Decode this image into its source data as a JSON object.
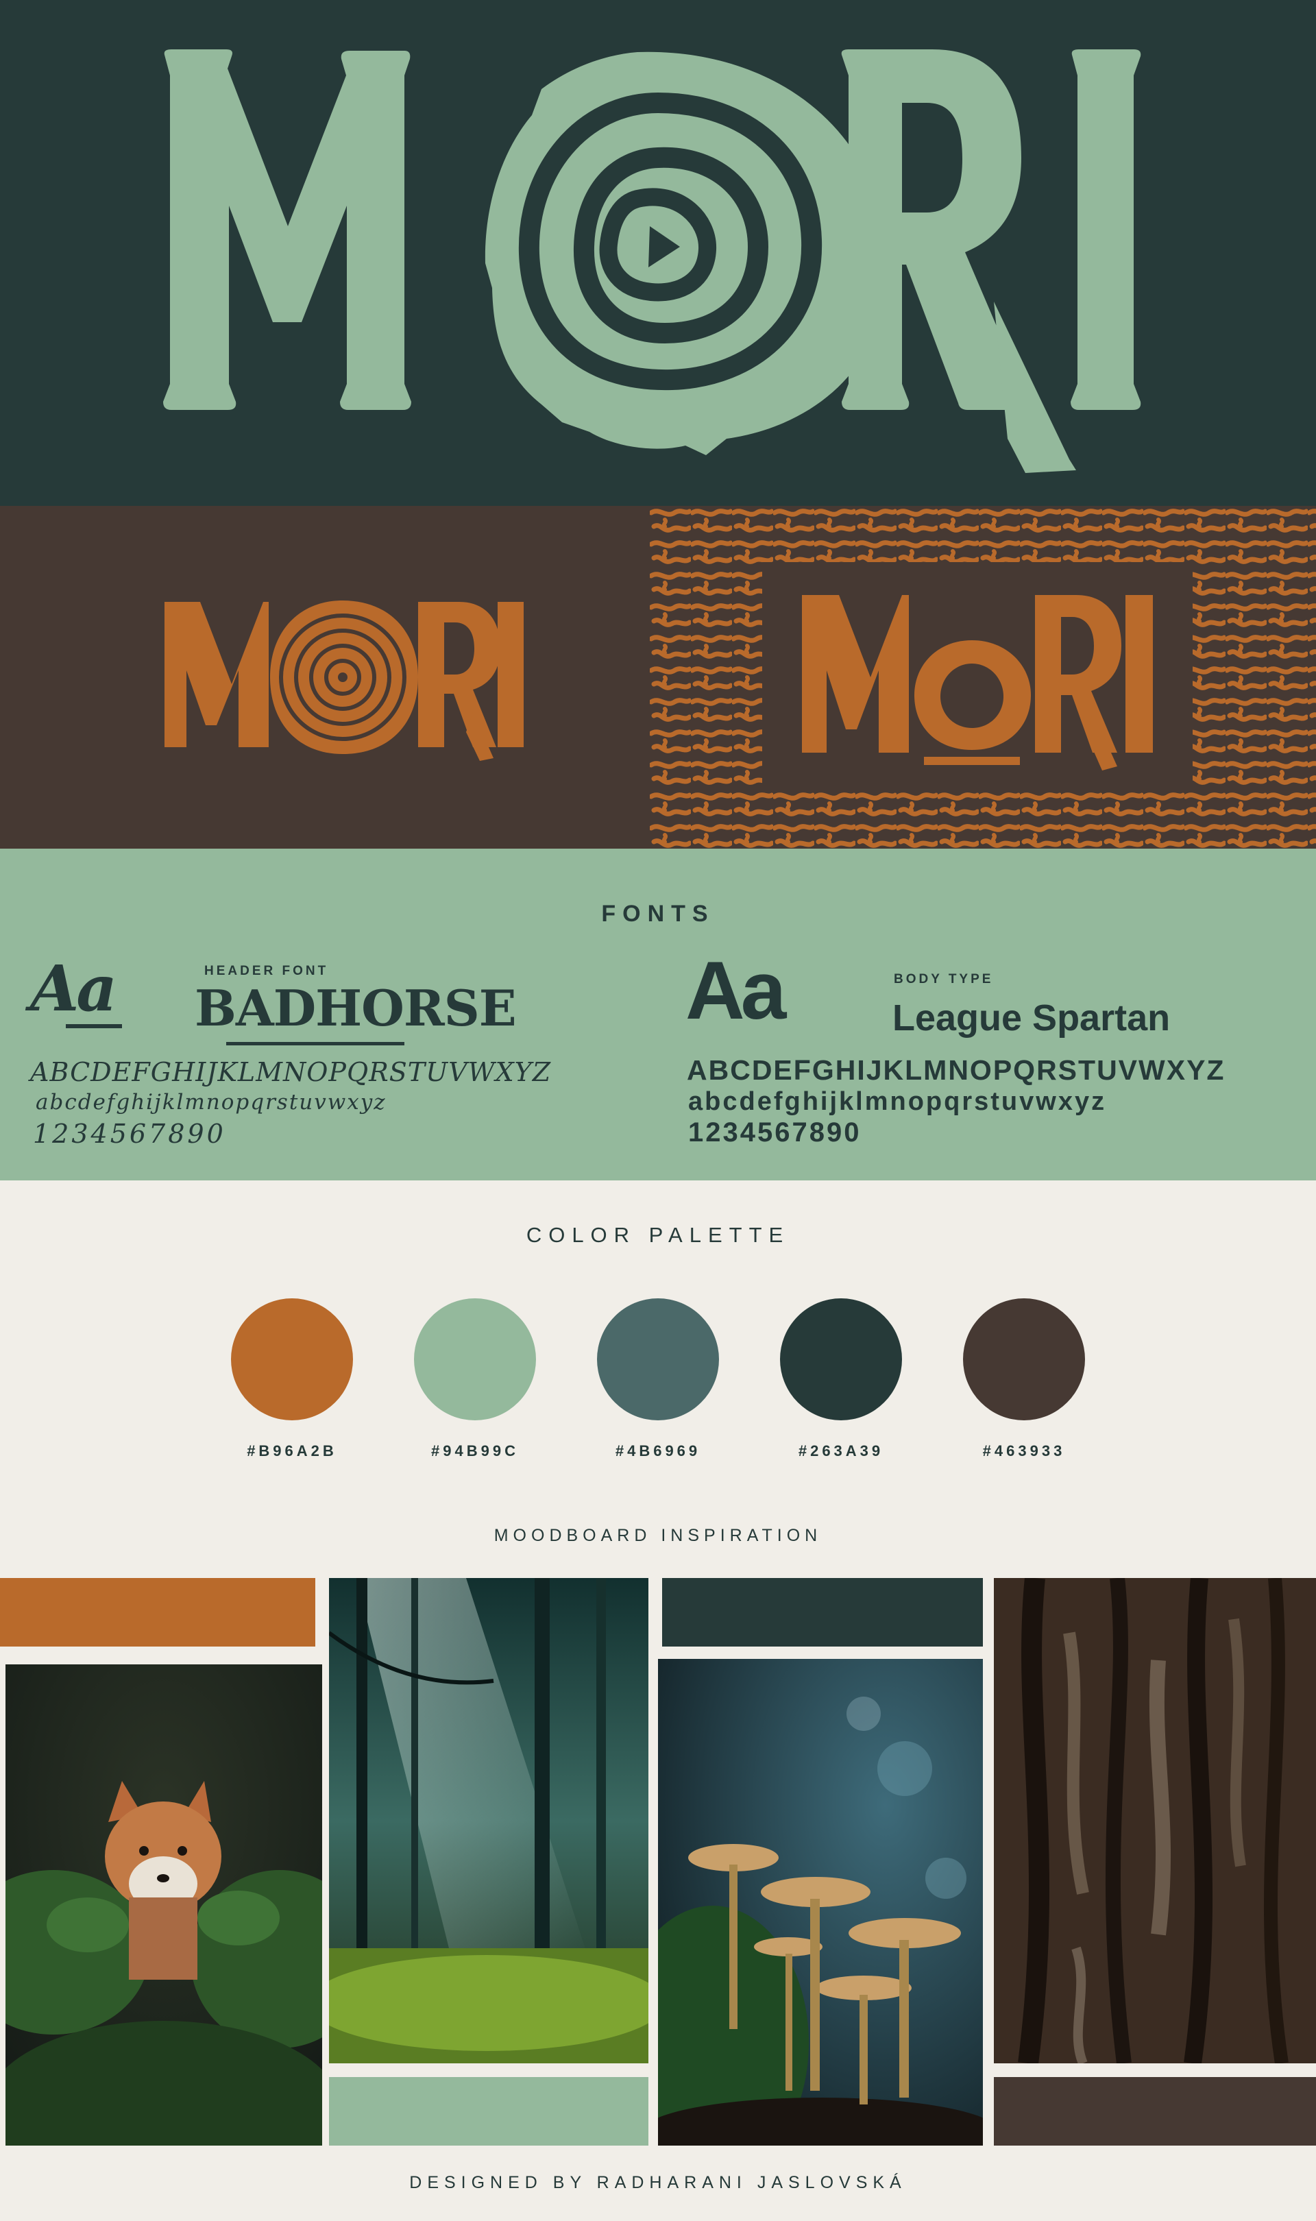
{
  "brand": {
    "name": "MORI"
  },
  "fonts_section": {
    "title": "FONTS",
    "header_font": {
      "sample": "Aa",
      "label": "HEADER FONT",
      "name": "BADHORSE",
      "uppercase": "ABCDEFGHIJKLMNOPQRSTUVWXYZ",
      "lowercase": "abcdefghijklmnopqrstuvwxyz",
      "digits": "1234567890"
    },
    "body_font": {
      "sample": "Aa",
      "label": "BODY TYPE",
      "name": "League Spartan",
      "uppercase": "ABCDEFGHIJKLMNOPQRSTUVWXYZ",
      "lowercase": "abcdefghijklmnopqrstuvwxyz",
      "digits": "1234567890"
    }
  },
  "palette": {
    "title": "COLOR PALETTE",
    "colors": [
      {
        "hex": "#B96A2B",
        "label": "#B96A2B"
      },
      {
        "hex": "#94B99C",
        "label": "#94B99C"
      },
      {
        "hex": "#4B6969",
        "label": "#4B6969"
      },
      {
        "hex": "#263A39",
        "label": "#263A39"
      },
      {
        "hex": "#463933",
        "label": "#463933"
      }
    ]
  },
  "moodboard": {
    "title": "MOODBOARD INSPIRATION",
    "photos": [
      "fox",
      "misty-forest",
      "mushrooms",
      "tree-bark"
    ]
  },
  "footer": {
    "credit": "DESIGNED BY RADHARANI JASLOVSKÁ"
  }
}
